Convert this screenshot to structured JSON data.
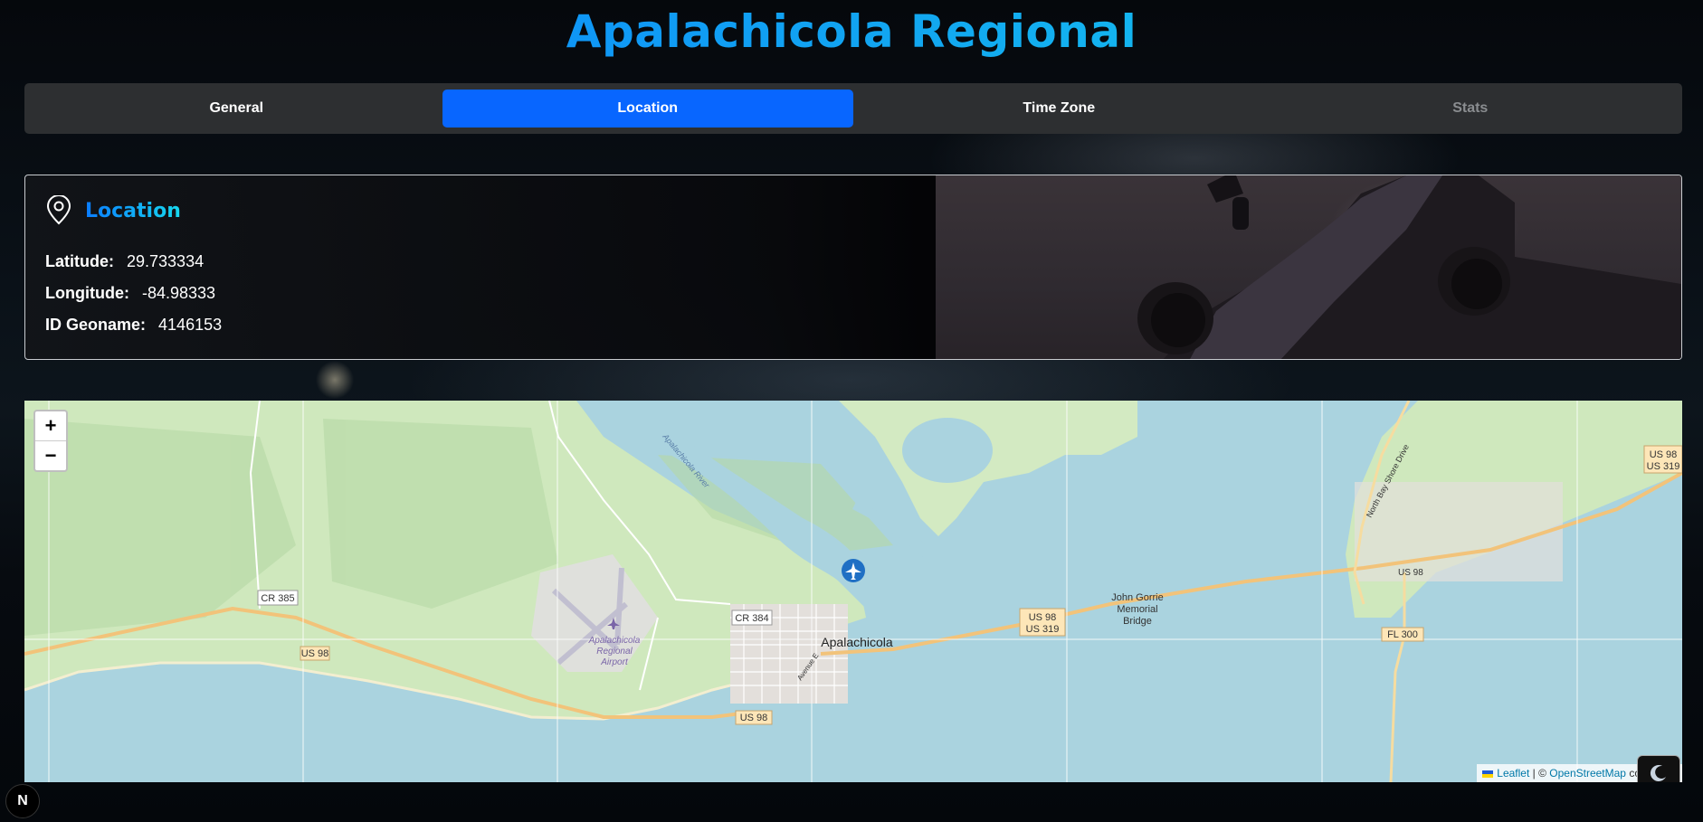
{
  "page": {
    "title": "Apalachicola Regional"
  },
  "tabs": [
    {
      "label": "General",
      "state": "normal"
    },
    {
      "label": "Location",
      "state": "active"
    },
    {
      "label": "Time Zone",
      "state": "normal"
    },
    {
      "label": "Stats",
      "state": "disabled"
    }
  ],
  "location_card": {
    "title": "Location",
    "icon": "map-pin-icon",
    "fields": [
      {
        "label": "Latitude:",
        "value": "29.733334"
      },
      {
        "label": "Longitude:",
        "value": "-84.98333"
      },
      {
        "label": "ID Geoname:",
        "value": "4146153"
      }
    ]
  },
  "map": {
    "zoom_in": "+",
    "zoom_out": "−",
    "marker_icon": "airplane-marker-icon",
    "labels": {
      "city": "Apalachicola",
      "airport_line1": "Apalachicola",
      "airport_line2": "Regional",
      "airport_line3": "Airport",
      "bridge_line1": "John Gorrie",
      "bridge_line2": "Memorial",
      "bridge_line3": "Bridge",
      "river": "Apalachicola River",
      "drive": "North Bay Shore Drive",
      "avenue": "Avenue E",
      "shield_cr385": "CR 385",
      "shield_cr384": "CR 384",
      "shield_us98_a": "US 98",
      "shield_us98_b": "US 98",
      "shield_us98_c": "US 98",
      "shield_us98_d": "US 98",
      "shield_us98_e": "US 98",
      "shield_us319": "US 319",
      "shield_us319_b": "US 319",
      "shield_fl300": "FL 300"
    },
    "attribution": {
      "leaflet": "Leaflet",
      "separator": " | © ",
      "osm": "OpenStreetMap",
      "suffix": " cont"
    },
    "theme_toggle_icon": "moon-icon"
  },
  "framework_badge": "N",
  "colors": {
    "accent": "#0866ff",
    "title_gradient_start": "#0a7cff",
    "title_gradient_end": "#17d8ee",
    "water": "#aad3df",
    "land": "#cfe8bd"
  }
}
